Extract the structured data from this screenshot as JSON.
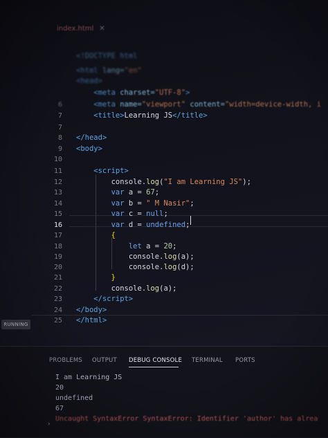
{
  "tab": {
    "filename": "index.html",
    "close": "✕"
  },
  "editor": {
    "active_line": "16",
    "lines": [
      {
        "n": "",
        "parts": [
          {
            "t": "<!DOCTYPE ",
            "c": "tag"
          },
          {
            "t": "html",
            "c": "tagname"
          }
        ]
      },
      {
        "n": "",
        "parts": [
          {
            "t": "<html ",
            "c": "tag"
          },
          {
            "t": "lang=",
            "c": "attr"
          },
          {
            "t": "\"en\"",
            "c": "str"
          }
        ]
      },
      {
        "n": "",
        "parts": [
          {
            "t": "<head>",
            "c": "tag"
          }
        ]
      },
      {
        "n": "",
        "parts": [
          {
            "t": "    <",
            "c": "tag"
          },
          {
            "t": "meta ",
            "c": "tagname"
          },
          {
            "t": "charset=",
            "c": "attr"
          },
          {
            "t": "\"UTF-8\"",
            "c": "str"
          },
          {
            "t": ">",
            "c": "tag"
          }
        ]
      },
      {
        "n": "6",
        "parts": [
          {
            "t": "    <",
            "c": "tag"
          },
          {
            "t": "meta ",
            "c": "tagname"
          },
          {
            "t": "name=",
            "c": "attr"
          },
          {
            "t": "\"viewport\" ",
            "c": "str"
          },
          {
            "t": "content=",
            "c": "attr"
          },
          {
            "t": "\"width=device-width, i",
            "c": "str"
          }
        ]
      },
      {
        "n": "7",
        "parts": [
          {
            "t": "    <",
            "c": "tag"
          },
          {
            "t": "title",
            "c": "tagname"
          },
          {
            "t": ">",
            "c": "tag"
          },
          {
            "t": "Learning JS",
            "c": "plain"
          },
          {
            "t": "</",
            "c": "tag"
          },
          {
            "t": "title",
            "c": "tagname"
          },
          {
            "t": ">",
            "c": "tag"
          }
        ]
      },
      {
        "n": "7",
        "parts": []
      },
      {
        "n": "8",
        "parts": [
          {
            "t": "</",
            "c": "tag"
          },
          {
            "t": "head",
            "c": "tagname"
          },
          {
            "t": ">",
            "c": "tag"
          }
        ]
      },
      {
        "n": "9",
        "parts": [
          {
            "t": "<",
            "c": "tag"
          },
          {
            "t": "body",
            "c": "tagname"
          },
          {
            "t": ">",
            "c": "tag"
          }
        ]
      },
      {
        "n": "10",
        "parts": []
      },
      {
        "n": "11",
        "parts": [
          {
            "t": "    <",
            "c": "tag"
          },
          {
            "t": "script",
            "c": "tagname"
          },
          {
            "t": ">",
            "c": "tag"
          }
        ]
      },
      {
        "n": "12",
        "parts": [
          {
            "t": "        console.",
            "c": "plain"
          },
          {
            "t": "log",
            "c": "fn"
          },
          {
            "t": "(",
            "c": "plain"
          },
          {
            "t": "\"I am Learning JS\"",
            "c": "str"
          },
          {
            "t": ");",
            "c": "plain"
          }
        ]
      },
      {
        "n": "13",
        "parts": [
          {
            "t": "        var ",
            "c": "kw"
          },
          {
            "t": "a = ",
            "c": "plain"
          },
          {
            "t": "67",
            "c": "num"
          },
          {
            "t": ";",
            "c": "plain"
          }
        ]
      },
      {
        "n": "14",
        "parts": [
          {
            "t": "        var ",
            "c": "kw"
          },
          {
            "t": "b = ",
            "c": "plain"
          },
          {
            "t": "\" M Nasir\"",
            "c": "str"
          },
          {
            "t": ";",
            "c": "plain"
          }
        ]
      },
      {
        "n": "15",
        "parts": [
          {
            "t": "        var ",
            "c": "kw"
          },
          {
            "t": "c = ",
            "c": "plain"
          },
          {
            "t": "null",
            "c": "kw"
          },
          {
            "t": ";",
            "c": "plain"
          }
        ]
      },
      {
        "n": "16",
        "parts": [
          {
            "t": "        var ",
            "c": "kw"
          },
          {
            "t": "d = ",
            "c": "plain"
          },
          {
            "t": "undefined",
            "c": "kw"
          },
          {
            "t": ";",
            "c": "plain"
          }
        ]
      },
      {
        "n": "17",
        "parts": [
          {
            "t": "        {",
            "c": "brace"
          }
        ]
      },
      {
        "n": "18",
        "parts": [
          {
            "t": "            let ",
            "c": "kw"
          },
          {
            "t": "a = ",
            "c": "plain"
          },
          {
            "t": "20",
            "c": "num"
          },
          {
            "t": ";",
            "c": "plain"
          }
        ]
      },
      {
        "n": "19",
        "parts": [
          {
            "t": "            console.",
            "c": "plain"
          },
          {
            "t": "log",
            "c": "fn"
          },
          {
            "t": "(a);",
            "c": "plain"
          }
        ]
      },
      {
        "n": "20",
        "parts": [
          {
            "t": "            console.",
            "c": "plain"
          },
          {
            "t": "log",
            "c": "fn"
          },
          {
            "t": "(d);",
            "c": "plain"
          }
        ]
      },
      {
        "n": "21",
        "parts": [
          {
            "t": "        }",
            "c": "brace"
          }
        ]
      },
      {
        "n": "22",
        "parts": [
          {
            "t": "        console.",
            "c": "plain"
          },
          {
            "t": "log",
            "c": "fn"
          },
          {
            "t": "(a);",
            "c": "plain"
          }
        ]
      },
      {
        "n": "23",
        "parts": [
          {
            "t": "    </",
            "c": "tag"
          },
          {
            "t": "script",
            "c": "tagname"
          },
          {
            "t": ">",
            "c": "tag"
          }
        ]
      },
      {
        "n": "24",
        "parts": [
          {
            "t": "</",
            "c": "tag"
          },
          {
            "t": "body",
            "c": "tagname"
          },
          {
            "t": ">",
            "c": "tag"
          }
        ]
      },
      {
        "n": "25",
        "parts": [
          {
            "t": "</",
            "c": "tag"
          },
          {
            "t": "html",
            "c": "tagname"
          },
          {
            "t": ">",
            "c": "tag"
          }
        ]
      }
    ]
  },
  "status": {
    "running_label": "RUNNING"
  },
  "panel": {
    "tabs": [
      "PROBLEMS",
      "OUTPUT",
      "DEBUG CONSOLE",
      "TERMINAL",
      "PORTS"
    ],
    "active_tab": "DEBUG CONSOLE",
    "output": [
      "I am Learning JS",
      "20",
      "undefined",
      "67"
    ],
    "error": "Uncaught SyntaxError SyntaxError: Identifier 'author' has alrea",
    "prompt_icon": "chevron-right-icon",
    "prompt_glyph": "›"
  },
  "colors": {
    "keyword": "#6aa3e8",
    "string": "#d98a5c",
    "number": "#b5cea8",
    "error": "#c35c5c"
  }
}
